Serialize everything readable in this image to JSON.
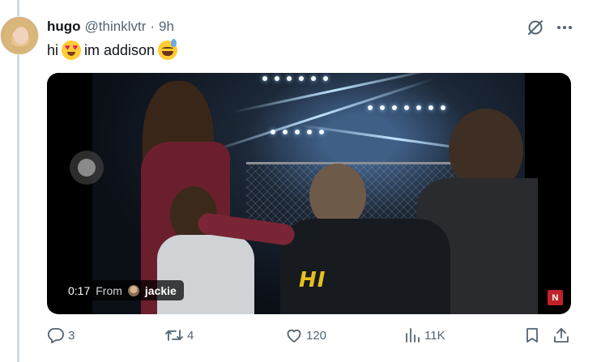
{
  "tweet": {
    "author_name": "hugo",
    "author_handle": "@thinklvtr",
    "separator": "·",
    "time": "9h",
    "text_before": "hi",
    "text_middle": "im addison",
    "emoji_1": "smiling-face-with-heart-eyes",
    "emoji_2": "grinning-face-with-sweat"
  },
  "video": {
    "overlay_caption": "HI",
    "elapsed": "0:17",
    "from_label": "From",
    "source_name": "jackie",
    "badge": "N"
  },
  "actions": {
    "replies": "3",
    "reposts": "4",
    "likes": "120",
    "views": "11K"
  },
  "icons": {
    "header": [
      "grok-icon",
      "more-icon"
    ],
    "actions": [
      "reply-icon",
      "repost-icon",
      "like-icon",
      "views-icon",
      "bookmark-icon",
      "share-icon"
    ]
  },
  "colors": {
    "text": "#0f1419",
    "muted": "#536471",
    "thread_line": "#cfd9de",
    "badge": "#c0222b"
  }
}
